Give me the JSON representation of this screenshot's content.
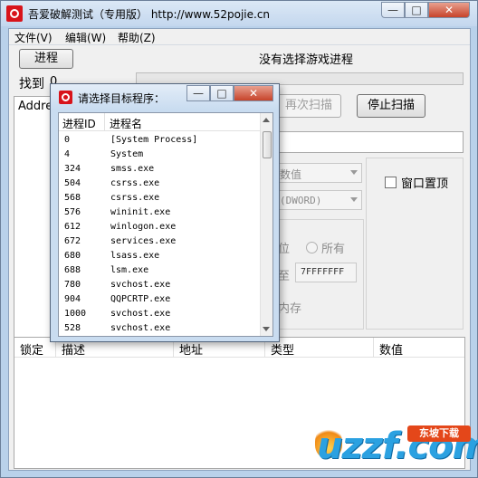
{
  "window": {
    "title": "吾爱破解测试（专用版）  http://www.52pojie.cn",
    "minimize_glyph": "—",
    "maximize_glyph": "□",
    "close_glyph": "✕"
  },
  "menu": [
    {
      "label": "文件(V)"
    },
    {
      "label": "编辑(W)"
    },
    {
      "label": "帮助(Z)"
    }
  ],
  "toolbar": {
    "process_button": "进程",
    "status_text": "没有选择游戏进程",
    "found_label": "找到",
    "found_count": "0",
    "rescan_button": "再次扫描",
    "stop_scan_button": "停止扫描",
    "address_header": "Addre"
  },
  "options": {
    "value_type": "数值",
    "data_type": "(DWORD)",
    "window_topmost": "窗口置顶",
    "radio_bit": "位",
    "radio_all": "所有",
    "range_end": "7FFFFFFF",
    "memory_label": "内存",
    "range_prefix": "至"
  },
  "result_table": {
    "columns": [
      "锁定",
      "描述",
      "地址",
      "类型",
      "数值"
    ]
  },
  "dialog": {
    "title": "请选择目标程序：",
    "columns": [
      "进程ID",
      "进程名"
    ],
    "rows": [
      {
        "pid": "0",
        "name": "[System Process]"
      },
      {
        "pid": "4",
        "name": "System"
      },
      {
        "pid": "324",
        "name": "smss.exe"
      },
      {
        "pid": "504",
        "name": "csrss.exe"
      },
      {
        "pid": "568",
        "name": "csrss.exe"
      },
      {
        "pid": "576",
        "name": "wininit.exe"
      },
      {
        "pid": "612",
        "name": "winlogon.exe"
      },
      {
        "pid": "672",
        "name": "services.exe"
      },
      {
        "pid": "680",
        "name": "lsass.exe"
      },
      {
        "pid": "688",
        "name": "lsm.exe"
      },
      {
        "pid": "780",
        "name": "svchost.exe"
      },
      {
        "pid": "904",
        "name": "QQPCRTP.exe"
      },
      {
        "pid": "1000",
        "name": "svchost.exe"
      },
      {
        "pid": "528",
        "name": "svchost.exe"
      }
    ]
  },
  "watermark": {
    "text": "uzzf.com",
    "badge": "东坡下载"
  },
  "colors": {
    "titlebar": "#c4d7ee",
    "close_red": "#c7432a",
    "icon_red": "#d8141b",
    "watermark_blue": "#2ba1e1",
    "badge_orange": "#e4471a"
  }
}
